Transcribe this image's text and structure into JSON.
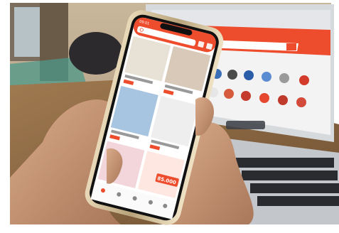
{
  "phone": {
    "time": "09:01",
    "flash_sale_price": "85.000"
  },
  "colors": {
    "shopee_orange": "#ee4d2d",
    "laptop_silver": "#cfd3d8",
    "skin": "#c99a7a",
    "wood": "#8a6a45"
  },
  "icons": [
    "search-icon",
    "cart-icon",
    "chat-icon",
    "home-icon",
    "user-icon"
  ]
}
